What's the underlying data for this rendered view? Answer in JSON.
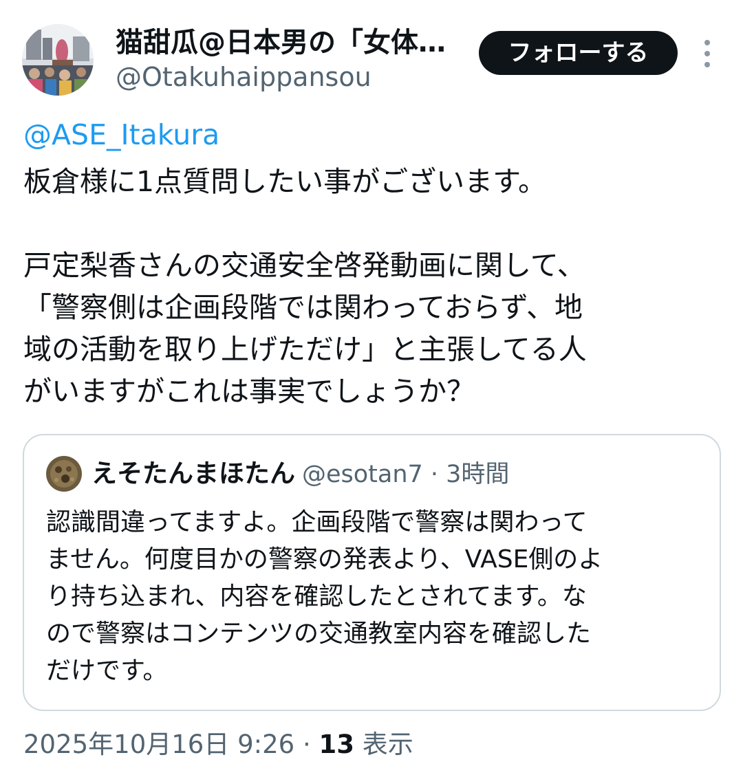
{
  "author": {
    "display_name": "猫甜瓜@日本男の「女体…",
    "handle": "@Otakuhaippansou"
  },
  "follow_button_label": "フォローする",
  "more_icon": "more-vertical-icon",
  "tweet": {
    "mention": "@ASE_Itakura",
    "lines": [
      "板倉様に1点質問したい事がございます。",
      "",
      "戸定梨香さんの交通安全啓発動画に関して、",
      "「警察側は企画段階では関わっておらず、地",
      "域の活動を取り上げただけ」と主張してる人",
      "がいますがこれは事実でしょうか？"
    ]
  },
  "quote": {
    "display_name": "えそたんまほたん",
    "handle": "@esotan7",
    "separator": "·",
    "time": "3時間",
    "lines": [
      "認識間違ってますよ。企画段階で警察は関わって",
      "ません。何度目かの警察の発表より、VASE側のよ",
      "り持ち込まれ、内容を確認したとされてます。な",
      "ので警察はコンテンツの交通教室内容を確認した",
      "だけです。"
    ]
  },
  "footer": {
    "timestamp": "2025年10月16日 9:26",
    "separator": "·",
    "views_count": "13",
    "views_label": "表示"
  },
  "colors": {
    "text": "#0f1419",
    "secondary_text": "#536471",
    "link": "#1d9bf0",
    "border": "#cfd9de",
    "button_bg": "#0f1419"
  }
}
